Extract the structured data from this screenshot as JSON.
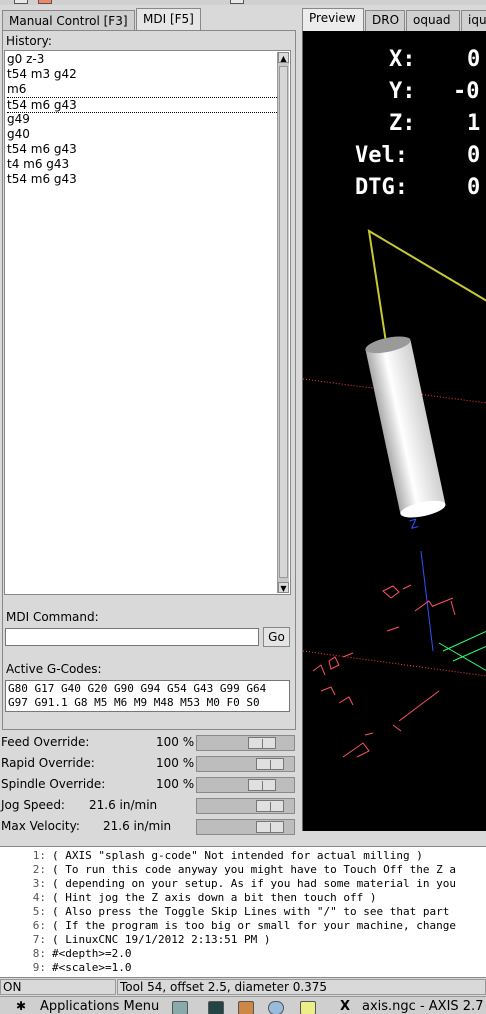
{
  "left_tabs": [
    {
      "label": "Manual Control [F3]"
    },
    {
      "label": "MDI [F5]"
    }
  ],
  "mdi": {
    "history_label": "History:",
    "history": [
      "g0 z-3",
      "t54 m3 g42",
      "m6",
      "t54 m6 g43",
      "g49",
      "g40",
      "t54 m6 g43",
      "t4 m6 g43",
      "t54 m6 g43"
    ],
    "selected_index": 3,
    "command_label": "MDI Command:",
    "command_value": "",
    "go_label": "Go",
    "active_label": "Active G-Codes:",
    "active_codes_line1": "G80 G17 G40 G20 G90 G94 G54 G43 G99 G64",
    "active_codes_line2": "G97 G91.1 G8 M5 M6 M9 M48 M53 M0 F0 S0"
  },
  "overrides": [
    {
      "name": "Feed Override:",
      "value": "100 %",
      "level": 0.77
    },
    {
      "name": "Rapid Override:",
      "value": "100 %",
      "level": 0.88
    },
    {
      "name": "Spindle Override:",
      "value": "100 %",
      "level": 0.77
    },
    {
      "name": "Jog Speed:",
      "value": "21.6 in/min",
      "level": 0.88
    },
    {
      "name": "Max Velocity:",
      "value": "21.6 in/min",
      "level": 0.88
    }
  ],
  "right_tabs": [
    {
      "label": "Preview"
    },
    {
      "label": "DRO"
    },
    {
      "label": "oquad"
    },
    {
      "label": "iqu"
    }
  ],
  "dro": [
    {
      "axis": "X:",
      "value": "0"
    },
    {
      "axis": "Y:",
      "value": "-0"
    },
    {
      "axis": "Z:",
      "value": "1"
    },
    {
      "axis": "Vel:",
      "value": "0"
    },
    {
      "axis": "DTG:",
      "value": "0"
    }
  ],
  "code_lines": [
    {
      "n": "1:",
      "text": "( AXIS \"splash g-code\" Not intended for actual milling )"
    },
    {
      "n": "2:",
      "text": "( To run this code anyway you might have to Touch Off the Z a"
    },
    {
      "n": "3:",
      "text": "( depending on your setup. As if you had some material in you"
    },
    {
      "n": "4:",
      "text": "( Hint jog the Z axis down a bit then touch off )"
    },
    {
      "n": "5:",
      "text": "( Also press the Toggle Skip Lines with \"/\" to see that part"
    },
    {
      "n": "6:",
      "text": "( If the program is too big or small for your machine, change"
    },
    {
      "n": "7:",
      "text": "( LinuxCNC 19/1/2012 2:13:51 PM )"
    },
    {
      "n": "8:",
      "text": "#<depth>=2.0"
    },
    {
      "n": "9:",
      "text": "#<scale>=1.0"
    }
  ],
  "status": {
    "machine": "ON",
    "tool": "Tool 54, offset 2.5, diameter 0.375"
  },
  "taskbar": {
    "apps_menu": "Applications Menu",
    "window": "axis.ngc - AXIS 2.7"
  },
  "colors": {
    "tool_path": "#c8c832",
    "rapid": "#ff4040",
    "grid": "#30ff70",
    "axis_blue": "#3050ff"
  }
}
